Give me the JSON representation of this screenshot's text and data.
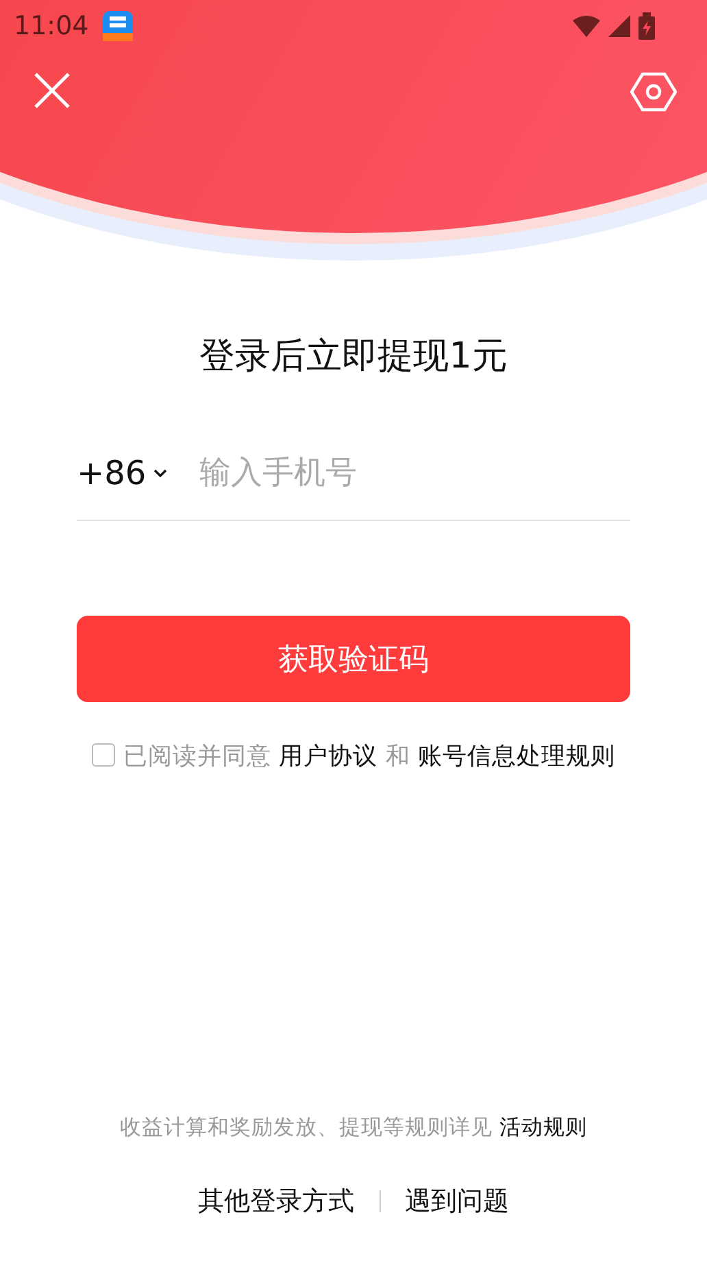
{
  "status_bar": {
    "time": "11:04"
  },
  "title": "登录后立即提现1元",
  "phone": {
    "country_code": "+86",
    "placeholder": "输入手机号"
  },
  "submit_button": "获取验证码",
  "agreement": {
    "checked": false,
    "parts": [
      {
        "kind": "text",
        "text": "已阅读并同意"
      },
      {
        "kind": "link",
        "text": "用户协议"
      },
      {
        "kind": "text",
        "text": "和"
      },
      {
        "kind": "link",
        "text": "账号信息处理规则"
      }
    ]
  },
  "rules_note": {
    "text": "收益计算和奖励发放、提现等规则详见",
    "link": "活动规则"
  },
  "footer_links": [
    "其他登录方式",
    "遇到问题"
  ]
}
